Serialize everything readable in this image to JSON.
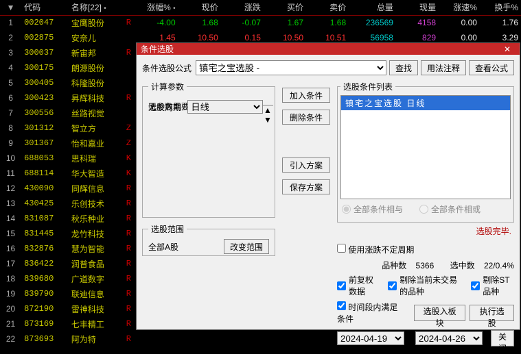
{
  "headers": {
    "idx": "▼",
    "code": "代码",
    "name": "名称[22]",
    "chg": "涨幅%",
    "price": "现价",
    "diff": "涨跌",
    "bid": "买价",
    "ask": "卖价",
    "vol": "总量",
    "cur": "现量",
    "speed": "涨速%",
    "turn": "换手%",
    "dot": "•"
  },
  "rows": [
    {
      "n": "1",
      "code": "002047",
      "name": "宝鹰股份",
      "flag": "R",
      "chg": "-4.00",
      "price": "1.68",
      "diff": "-0.07",
      "bid": "1.67",
      "ask": "1.68",
      "vol": "236569",
      "cur": "4158",
      "speed": "0.00",
      "turn": "1.76",
      "cls": "green"
    },
    {
      "n": "2",
      "code": "002875",
      "name": "安奈儿",
      "flag": "",
      "chg": "1.45",
      "price": "10.50",
      "diff": "0.15",
      "bid": "10.50",
      "ask": "10.51",
      "vol": "56958",
      "cur": "829",
      "speed": "0.00",
      "turn": "3.29",
      "cls": "red"
    },
    {
      "n": "3",
      "code": "300037",
      "name": "新宙邦",
      "flag": "R"
    },
    {
      "n": "4",
      "code": "300175",
      "name": "朗源股份",
      "flag": ""
    },
    {
      "n": "5",
      "code": "300405",
      "name": "科隆股份",
      "flag": ""
    },
    {
      "n": "6",
      "code": "300423",
      "name": "昇辉科技",
      "flag": "R"
    },
    {
      "n": "7",
      "code": "300556",
      "name": "丝路视觉",
      "flag": ""
    },
    {
      "n": "8",
      "code": "301312",
      "name": "智立方",
      "flag": "Z"
    },
    {
      "n": "9",
      "code": "301367",
      "name": "怡和嘉业",
      "flag": "Z"
    },
    {
      "n": "10",
      "code": "688053",
      "name": "思科瑞",
      "flag": "K"
    },
    {
      "n": "11",
      "code": "688114",
      "name": "华大智造",
      "flag": "K"
    },
    {
      "n": "12",
      "code": "430090",
      "name": "同辉信息",
      "flag": "R"
    },
    {
      "n": "13",
      "code": "430425",
      "name": "乐创技术",
      "flag": "R"
    },
    {
      "n": "14",
      "code": "831087",
      "name": "秋乐种业",
      "flag": "R"
    },
    {
      "n": "15",
      "code": "831445",
      "name": "龙竹科技",
      "flag": "R"
    },
    {
      "n": "16",
      "code": "832876",
      "name": "慧为智能",
      "flag": "R"
    },
    {
      "n": "17",
      "code": "836422",
      "name": "润普食品",
      "flag": "R"
    },
    {
      "n": "18",
      "code": "839680",
      "name": "广道数字",
      "flag": "R"
    },
    {
      "n": "19",
      "code": "839790",
      "name": "联迪信息",
      "flag": "R"
    },
    {
      "n": "20",
      "code": "872190",
      "name": "雷神科技",
      "flag": "R"
    },
    {
      "n": "21",
      "code": "873169",
      "name": "七丰精工",
      "flag": "R"
    },
    {
      "n": "22",
      "code": "873693",
      "name": "阿为特",
      "flag": "R"
    }
  ],
  "dialog": {
    "title": "条件选股",
    "close": "✕",
    "label_formula": "条件选股公式",
    "formula_value": "镇宅之宝选股 -",
    "btn_find": "查找",
    "btn_usage": "用法注释",
    "btn_view": "查看公式",
    "grp_params": "计算参数",
    "params_text": "无参数需要设置",
    "label_period": "选股周期:",
    "period_value": "日线",
    "grp_scope": "选股范围",
    "scope_value": "全部A股",
    "btn_change_scope": "改变范围",
    "btn_add": "加入条件",
    "btn_del": "删除条件",
    "btn_load": "引入方案",
    "btn_save": "保存方案",
    "grp_condlist": "选股条件列表",
    "cond_item": "镇宅之宝选股  日线",
    "radio_and": "全部条件相与",
    "radio_or": "全部条件相或",
    "status": "选股完毕.",
    "chk_noperiod": "使用涨跌不定周期",
    "totals_kinds_label": "品种数",
    "totals_kinds_value": "5366",
    "totals_sel_label": "选中数",
    "totals_sel_value": "22/0.4%",
    "chk_fq": "前复权数据",
    "chk_rm_notrade": "剔除当前未交易的品种",
    "chk_rm_st": "剔除ST品种",
    "chk_timerange": "时间段内满足条件",
    "btn_toblock": "选股入板块",
    "btn_exec": "执行选股",
    "date_from": "2024-04-19",
    "date_to": "2024-04-26",
    "dash": "--",
    "btn_close": "关闭",
    "arrow_up": "▲",
    "arrow_dn": "▼"
  }
}
